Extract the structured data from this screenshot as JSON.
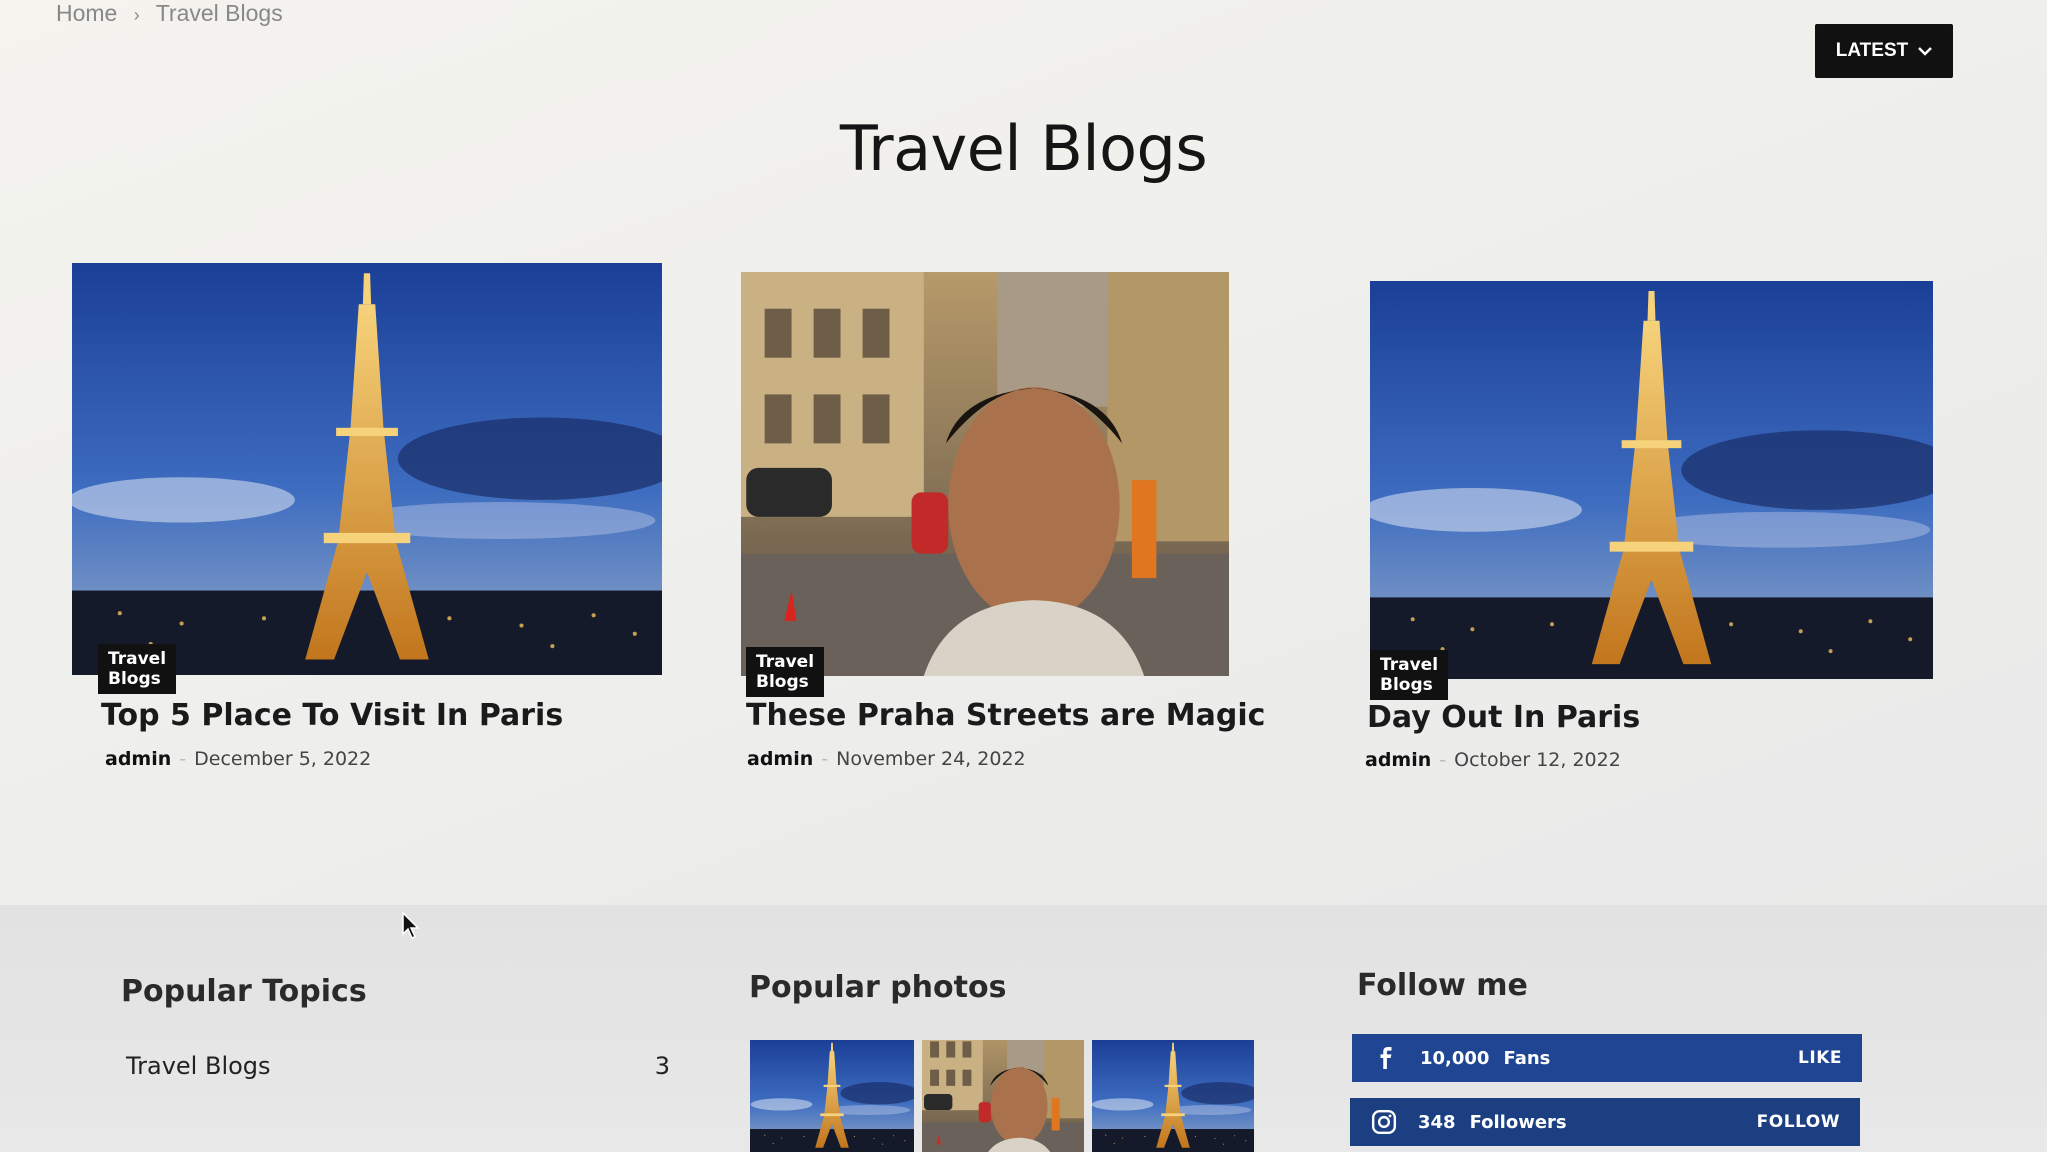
{
  "breadcrumb": {
    "home": "Home",
    "separator": "›",
    "current": "Travel Blogs"
  },
  "sort_button": {
    "label": "LATEST",
    "icon": "chevron-down-icon"
  },
  "page_title": "Travel Blogs",
  "posts": [
    {
      "category": "Travel Blogs",
      "title": "Top 5 Place To Visit In Paris",
      "author": "admin",
      "separator": "-",
      "date": "December 5, 2022",
      "image": "eiffel-tower-night"
    },
    {
      "category": "Travel Blogs",
      "title": "These Praha Streets are Magic",
      "author": "admin",
      "separator": "-",
      "date": "November 24, 2022",
      "image": "selfie-prague-street"
    },
    {
      "category": "Travel Blogs",
      "title": "Day Out In Paris",
      "author": "admin",
      "separator": "-",
      "date": "October 12, 2022",
      "image": "eiffel-tower-night"
    }
  ],
  "popular_topics": {
    "title": "Popular Topics",
    "items": [
      {
        "label": "Travel Blogs",
        "count": "3"
      }
    ]
  },
  "popular_photos": {
    "title": "Popular photos",
    "images": [
      "eiffel-tower-night",
      "selfie-prague-street",
      "eiffel-tower-night"
    ]
  },
  "follow_me": {
    "title": "Follow me",
    "facebook": {
      "icon": "facebook-icon",
      "count": "10,000",
      "label": "Fans",
      "action": "LIKE",
      "color": "#1f4593"
    },
    "instagram": {
      "icon": "instagram-icon",
      "count": "348",
      "label": "Followers",
      "action": "FOLLOW",
      "color": "#1c3f82"
    }
  }
}
